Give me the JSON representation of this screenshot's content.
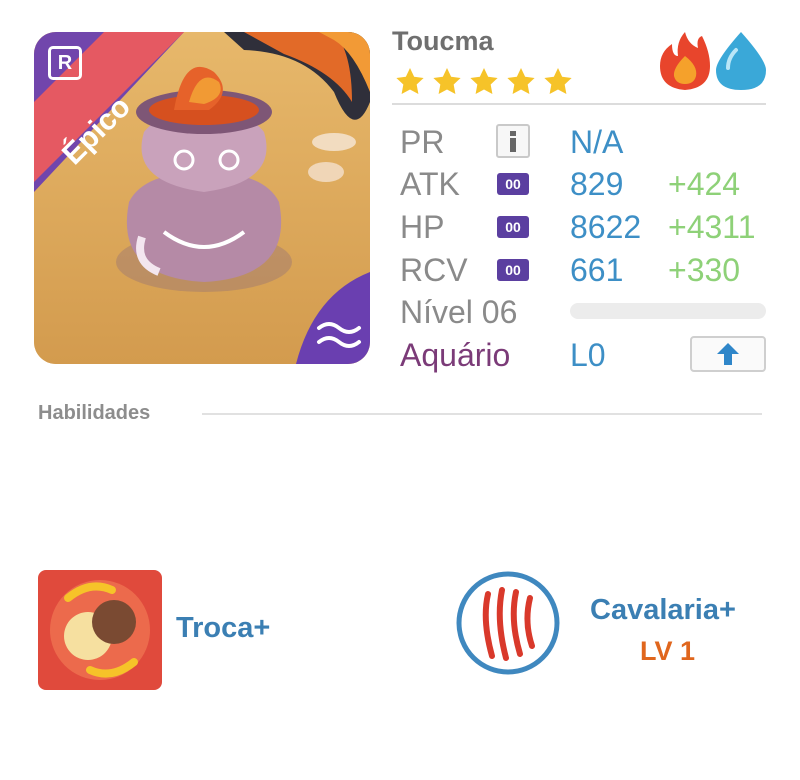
{
  "monster": {
    "name": "Toucma",
    "rarity": "Épico",
    "rarity_badge": "R",
    "stars": 5,
    "elements": [
      "fire-icon",
      "water-icon"
    ],
    "element_colors": [
      "#e8452c",
      "#3aa8d8"
    ]
  },
  "stats": {
    "pr": {
      "label": "PR",
      "value": "N/A"
    },
    "atk": {
      "label": "ATK",
      "badge": "00",
      "value": "829",
      "bonus": "+424"
    },
    "hp": {
      "label": "HP",
      "badge": "00",
      "value": "8622",
      "bonus": "+4311"
    },
    "rcv": {
      "label": "RCV",
      "badge": "00",
      "value": "661",
      "bonus": "+330"
    },
    "level": {
      "label": "Nível 06",
      "progress": 0
    },
    "habitat": {
      "label": "Aquário",
      "value": "L0"
    }
  },
  "skills_section": {
    "title": "Habilidades"
  },
  "skills": [
    {
      "name": "Troca+",
      "icon": "swap-skill-icon"
    },
    {
      "name": "Cavalaria+",
      "level": "LV 1",
      "icon": "claw-skill-icon"
    }
  ],
  "colors": {
    "accent": "#3b7fb3",
    "bonus": "#8ed178",
    "level": "#e0661d",
    "epic": "#6a3fb0"
  }
}
